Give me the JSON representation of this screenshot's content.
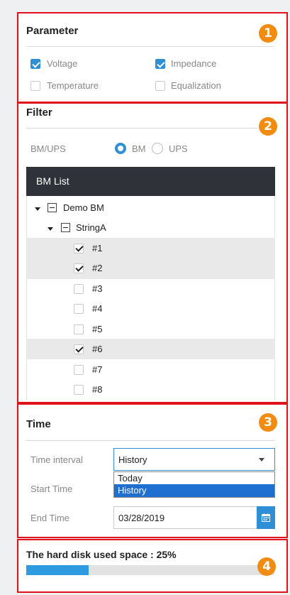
{
  "parameter": {
    "title": "Parameter",
    "options": [
      {
        "label": "Voltage",
        "checked": true
      },
      {
        "label": "Impedance",
        "checked": true
      },
      {
        "label": "Temperature",
        "checked": false
      },
      {
        "label": "Equalization",
        "checked": false
      }
    ]
  },
  "filter": {
    "title": "Filter",
    "mode_label": "BM/UPS",
    "mode_options": [
      {
        "label": "BM",
        "selected": true
      },
      {
        "label": "UPS",
        "selected": false
      }
    ],
    "list_title": "BM List",
    "tree_root": "Demo BM",
    "tree_child": "StringA",
    "items": [
      {
        "label": "#1",
        "checked": true
      },
      {
        "label": "#2",
        "checked": true
      },
      {
        "label": "#3",
        "checked": false
      },
      {
        "label": "#4",
        "checked": false
      },
      {
        "label": "#5",
        "checked": false
      },
      {
        "label": "#6",
        "checked": true
      },
      {
        "label": "#7",
        "checked": false
      },
      {
        "label": "#8",
        "checked": false
      }
    ]
  },
  "time": {
    "title": "Time",
    "interval_label": "Time interval",
    "interval_value": "History",
    "dropdown_options": [
      "Today",
      "History"
    ],
    "start_label": "Start Time",
    "end_label": "End Time",
    "end_value": "03/28/2019"
  },
  "disk": {
    "label": "The hard disk used space : 25%",
    "used_percent": 25
  },
  "badges": [
    "1",
    "2",
    "3",
    "4"
  ],
  "colors": {
    "accent": "#2e8fd6",
    "highlight": "#e9e9e9",
    "header": "#2f3238",
    "outline": "#e0121b",
    "badge": "#f28c10"
  }
}
